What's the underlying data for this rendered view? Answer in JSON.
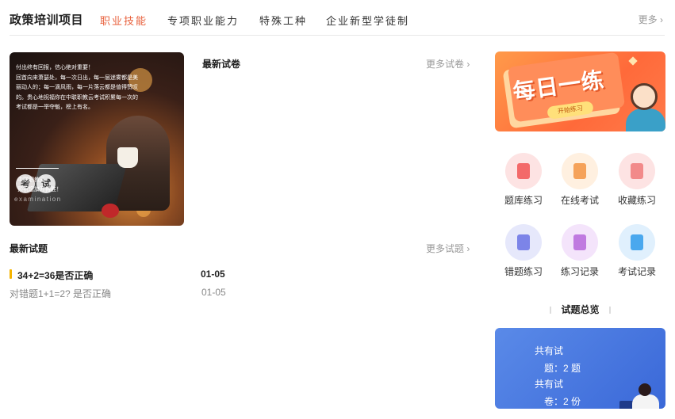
{
  "nav": {
    "brand": "政策培训项目",
    "tabs": [
      {
        "label": "职业技能",
        "active": true
      },
      {
        "label": "专项职业能力",
        "active": false
      },
      {
        "label": "特殊工种",
        "active": false
      },
      {
        "label": "企业新型学徒制",
        "active": false
      }
    ],
    "more": "更多 ›"
  },
  "banner": {
    "text_lines": [
      "付出终有回报，信心绝对重要！",
      "回首向来萧瑟处，每一次日出，每一层迷雾都是美",
      "丽动人的；每一滴风雨，每一片落云都是值得赞叹",
      "的。贵心地祝福你在中联职教云考试积累每一次的",
      "考试都是一举夺魁，榜上有名。"
    ],
    "seal_chars": [
      "考",
      "试"
    ],
    "en": "examination",
    "foot_lines": [
      "中联职教云",
      "预祝您旗开得胜！"
    ]
  },
  "latest_papers": {
    "title": "最新试卷",
    "more": "更多试卷 ›"
  },
  "latest_questions": {
    "title": "最新试题",
    "more": "更多试题 ›",
    "items": [
      {
        "text": "34+2=36是否正确",
        "date": "01-05"
      },
      {
        "text": "对错题1+1=2? 是否正确",
        "date": "01-05"
      }
    ]
  },
  "daily": {
    "title": "每日一练",
    "button": "开始练习"
  },
  "quick_links": [
    {
      "label": "题库练习",
      "bg": "#fde3e3",
      "fg": "#f36a6a"
    },
    {
      "label": "在线考试",
      "bg": "#fff0e0",
      "fg": "#f5a25a"
    },
    {
      "label": "收藏练习",
      "bg": "#fde3e3",
      "fg": "#f28a8a"
    },
    {
      "label": "错题练习",
      "bg": "#e6e8fb",
      "fg": "#7c84e8"
    },
    {
      "label": "练习记录",
      "bg": "#f4e4fb",
      "fg": "#c07ae0"
    },
    {
      "label": "考试记录",
      "bg": "#e0f0fd",
      "fg": "#4aa8ee"
    }
  ],
  "overview": {
    "title": "试题总览",
    "questions_label": "共有试",
    "questions_value": "题：2 题",
    "papers_label": "共有试",
    "papers_value": "卷：2 份"
  },
  "colors": {
    "accent": "#e8603c",
    "marker": "#f5b400"
  }
}
